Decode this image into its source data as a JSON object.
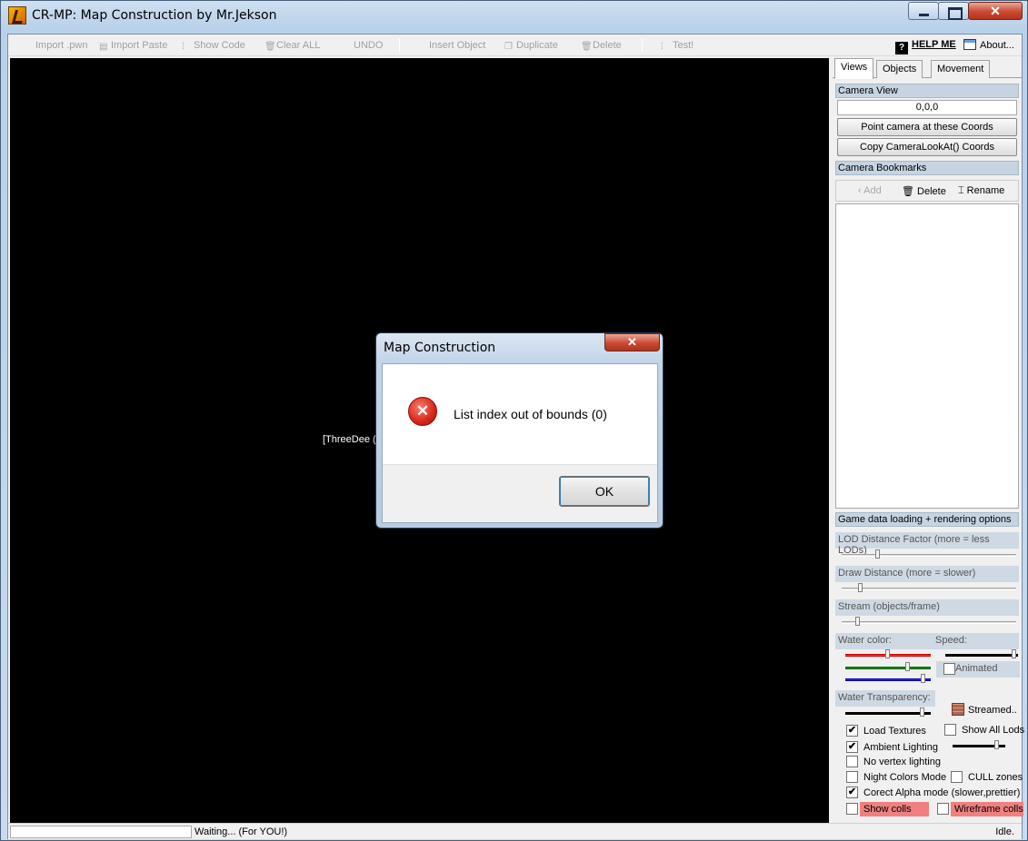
{
  "window": {
    "title": "CR-MP: Map Construction by Mr.Jekson"
  },
  "toolbar": {
    "import_pwn": "Import .pwn",
    "import_paste": "Import Paste",
    "show_code": "Show Code",
    "clear_all": "Clear ALL",
    "undo": "UNDO",
    "insert_object": "Insert Object",
    "duplicate": "Duplicate",
    "delete": "Delete",
    "test": "Test!",
    "help_me": "HELP ME",
    "about": "About..."
  },
  "viewport": {
    "label": "[ThreeDee ("
  },
  "status": {
    "message": "Waiting... (For YOU!)",
    "state": "Idle."
  },
  "panel": {
    "tabs": [
      "Views",
      "Objects",
      "Movement"
    ],
    "camera_view": "Camera View",
    "coords_value": "0,0,0",
    "point_camera": "Point camera at these Coords",
    "copy_lookat": "Copy CameraLookAt() Coords",
    "bookmarks": "Camera Bookmarks",
    "bm_add": "Add",
    "bm_delete": "Delete",
    "bm_rename": "Rename",
    "rendering_options": "Game data loading + rendering options",
    "lod_factor": "LOD Distance Factor (more = less LODs)",
    "draw_distance": "Draw Distance (more = slower)",
    "stream": "Stream (objects/frame)",
    "water_color": "Water color:",
    "speed": "Speed:",
    "animated": "Animated",
    "water_transparency": "Water Transparency:",
    "streamed": "Streamed..",
    "load_textures": "Load Textures",
    "show_all_lods": "Show All Lods",
    "ambient_lighting": "Ambient Lighting",
    "no_vertex_lighting": "No vertex lighting",
    "night_colors": "Night Colors Mode",
    "cull_zones": "CULL zones",
    "correct_alpha": "Corect Alpha mode (slower,prettier)",
    "show_colls": "Show colls",
    "wireframe_colls": "Wireframe colls",
    "check_mark": "✔",
    "checked": {
      "load_textures": true,
      "ambient_lighting": true,
      "correct_alpha": true,
      "show_all_lods": false,
      "animated": false,
      "no_vertex_lighting": false,
      "night_colors": false,
      "cull_zones": false,
      "show_colls": false,
      "wireframe_colls": false
    }
  },
  "dialog": {
    "title": "Map Construction",
    "message": "List index out of bounds (0)",
    "ok": "OK"
  },
  "colors": {
    "titlebar": "#b9d1ea",
    "close_red": "#c94a32",
    "section_header": "#c6d4e2",
    "pink_row": "#f08080"
  }
}
